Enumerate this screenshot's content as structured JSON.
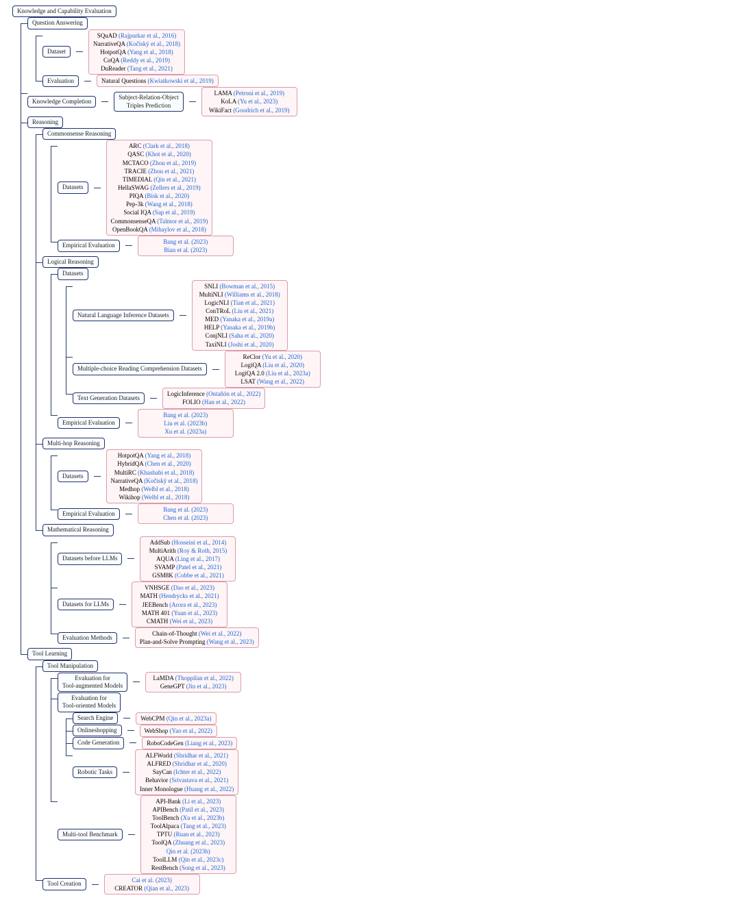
{
  "root": "Knowledge and Capability Evaluation",
  "qa": {
    "label": "Question Answering",
    "dataset": "Dataset",
    "dataset_items": [
      {
        "name": "SQuAD",
        "cite": "(Rajpurkar et al., 2016)"
      },
      {
        "name": "NarrativeQA",
        "cite": "(Kočiský et al., 2018)"
      },
      {
        "name": "HotpotQA",
        "cite": "(Yang et al., 2018)"
      },
      {
        "name": "CoQA",
        "cite": "(Reddy et al., 2019)"
      },
      {
        "name": "DuReader",
        "cite": "(Tang et al., 2021)"
      }
    ],
    "evaluation": "Evaluation",
    "eval_item": {
      "name": "Natural Questions",
      "cite": "(Kwiatkowski et al., 2019)"
    }
  },
  "kc": {
    "label": "Knowledge Completion",
    "sro": "Subject-Relation-Object\nTriples Prediction",
    "items": [
      {
        "name": "LAMA",
        "cite": "(Petroni et al., 2019)"
      },
      {
        "name": "KoLA",
        "cite": "(Yu et al., 2023)"
      },
      {
        "name": "WikiFact",
        "cite": "(Goodrich et al., 2019)"
      }
    ]
  },
  "reasoning": {
    "label": "Reasoning",
    "cs": {
      "label": "Commonsense Reasoning",
      "datasets": "Datasets",
      "ds_items": [
        {
          "name": "ARC",
          "cite": "(Clark et al., 2018)"
        },
        {
          "name": "QASC",
          "cite": "(Khot et al., 2020)"
        },
        {
          "name": "MCTACO",
          "cite": "(Zhou et al., 2019)"
        },
        {
          "name": "TRACIE",
          "cite": "(Zhou et al., 2021)"
        },
        {
          "name": "TIMEDIAL",
          "cite": "(Qin et al., 2021)"
        },
        {
          "name": "HellaSWAG",
          "cite": "(Zellers et al., 2019)"
        },
        {
          "name": "PIQA",
          "cite": "(Bisk et al., 2020)"
        },
        {
          "name": "Pep-3k",
          "cite": "(Wang et al., 2018)"
        },
        {
          "name": "Social IQA",
          "cite": "(Sap et al., 2019)"
        },
        {
          "name": "CommonsenseQA",
          "cite": "(Talmor et al., 2019)"
        },
        {
          "name": "OpenBookQA",
          "cite": "(Mihaylov et al., 2018)"
        }
      ],
      "emp": "Empirical Evaluation",
      "emp_items": [
        {
          "name": "",
          "cite": "Bang et al. (2023)"
        },
        {
          "name": "",
          "cite": "Bian et al. (2023)"
        }
      ]
    },
    "logical": {
      "label": "Logical Reasoning",
      "datasets": "Datasets",
      "nli": "Natural Language Inference Datasets",
      "nli_items": [
        {
          "name": "SNLI",
          "cite": "(Bowman et al., 2015)"
        },
        {
          "name": "MultiNLI",
          "cite": "(Williams et al., 2018)"
        },
        {
          "name": "LogicNLI",
          "cite": "(Tian et al., 2021)"
        },
        {
          "name": "ConTRoL",
          "cite": "(Liu et al., 2021)"
        },
        {
          "name": "MED",
          "cite": "(Yanaka et al., 2019a)"
        },
        {
          "name": "HELP",
          "cite": "(Yanaka et al., 2019b)"
        },
        {
          "name": "ConjNLI",
          "cite": "(Saha et al., 2020)"
        },
        {
          "name": "TaxiNLI",
          "cite": "(Joshi et al., 2020)"
        }
      ],
      "mcrc": "Multiple-choice Reading Comprehension Datasets",
      "mcrc_items": [
        {
          "name": "ReClor",
          "cite": "(Yu et al., 2020)"
        },
        {
          "name": "LogiQA",
          "cite": "(Liu et al., 2020)"
        },
        {
          "name": "LogiQA 2.0",
          "cite": "(Liu et al., 2023a)"
        },
        {
          "name": "LSAT",
          "cite": "(Wang et al., 2022)"
        }
      ],
      "tg": "Text Generation Datasets",
      "tg_items": [
        {
          "name": "LogicInference",
          "cite": "(Ontañón et al., 2022)"
        },
        {
          "name": "FOLIO",
          "cite": "(Han et al., 2022)"
        }
      ],
      "emp": "Empirical Evaluation",
      "emp_items": [
        {
          "name": "",
          "cite": "Bang et al. (2023)"
        },
        {
          "name": "",
          "cite": "Liu et al. (2023b)"
        },
        {
          "name": "",
          "cite": "Xu et al. (2023a)"
        }
      ]
    },
    "multihop": {
      "label": "Multi-hop Reasoning",
      "datasets": "Datasets",
      "ds_items": [
        {
          "name": "HotpotQA",
          "cite": "(Yang et al., 2018)"
        },
        {
          "name": "HybridQA",
          "cite": "(Chen et al., 2020)"
        },
        {
          "name": "MultiRC",
          "cite": "(Khashabi et al., 2018)"
        },
        {
          "name": "NarrativeQA",
          "cite": "(Kočiský et al., 2018)"
        },
        {
          "name": "Medhop",
          "cite": "(Welbl et al., 2018)"
        },
        {
          "name": "Wikihop",
          "cite": "(Welbl et al., 2018)"
        }
      ],
      "emp": "Empirical Evaluation",
      "emp_items": [
        {
          "name": "",
          "cite": "Bang et al. (2023)"
        },
        {
          "name": "",
          "cite": "Chen et al. (2023)"
        }
      ]
    },
    "math": {
      "label": "Mathematical Reasoning",
      "pre": "Datasets before LLMs",
      "pre_items": [
        {
          "name": "AddSub",
          "cite": "(Hosseini et al., 2014)"
        },
        {
          "name": "MultiArith",
          "cite": "(Roy & Roth, 2015)"
        },
        {
          "name": "AQUA",
          "cite": "(Ling et al., 2017)"
        },
        {
          "name": "SVAMP",
          "cite": "(Patel et al., 2021)"
        },
        {
          "name": "GSM8K",
          "cite": "(Cobbe et al., 2021)"
        }
      ],
      "for": "Datasets for LLMs",
      "for_items": [
        {
          "name": "VNHSGE",
          "cite": "(Dao et al., 2023)"
        },
        {
          "name": "MATH",
          "cite": "(Hendrycks et al., 2021)"
        },
        {
          "name": "JEEBench",
          "cite": "(Arora et al., 2023)"
        },
        {
          "name": "MATH 401",
          "cite": "(Yuan et al., 2023)"
        },
        {
          "name": "CMATH",
          "cite": "(Wei et al., 2023)"
        }
      ],
      "methods": "Evaluation Methods",
      "methods_items": [
        {
          "name": "Chain-of-Thought",
          "cite": "(Wei et al., 2022)"
        },
        {
          "name": "Plan-and-Solve Prompting",
          "cite": "(Wang et al., 2023)"
        }
      ]
    }
  },
  "tool": {
    "label": "Tool Learning",
    "manip": {
      "label": "Tool Manipulation",
      "aug": "Evaluation for\nTool-augmented Models",
      "aug_items": [
        {
          "name": "LaMDA",
          "cite": "(Thoppilan et al., 2022)"
        },
        {
          "name": "GeneGPT",
          "cite": "(Jin et al., 2023)"
        }
      ],
      "ori": "Evaluation for\nTool-oriented Models",
      "search": "Search Engine",
      "search_item": {
        "name": "WebCPM",
        "cite": "(Qin et al., 2023a)"
      },
      "shop": "Onlineshopping",
      "shop_item": {
        "name": "WebShop",
        "cite": "(Yao et al., 2022)"
      },
      "code": "Code Generation",
      "code_item": {
        "name": "RoboCodeGen",
        "cite": "(Liang et al., 2023)"
      },
      "robot": "Robotic Tasks",
      "robot_items": [
        {
          "name": "ALFWorld",
          "cite": "(Shridhar et al., 2021)"
        },
        {
          "name": "ALFRED",
          "cite": "(Shridhar et al., 2020)"
        },
        {
          "name": "SayCan",
          "cite": "(Ichter et al., 2022)"
        },
        {
          "name": "Behavior",
          "cite": "(Srivastava et al., 2021)"
        },
        {
          "name": "Inner Monologue",
          "cite": "(Huang et al., 2022)"
        }
      ],
      "multi": "Multi-tool Benchmark",
      "multi_items": [
        {
          "name": "API-Bank",
          "cite": "(Li et al., 2023)"
        },
        {
          "name": "APIBench",
          "cite": "(Patil et al., 2023)"
        },
        {
          "name": "ToolBench",
          "cite": "(Xu et al., 2023b)"
        },
        {
          "name": "ToolAlpaca",
          "cite": "(Tang et al., 2023)"
        },
        {
          "name": "TPTU",
          "cite": "(Ruan et al., 2023)"
        },
        {
          "name": "ToolQA",
          "cite": "(Zhuang et al., 2023)"
        },
        {
          "name": "",
          "cite": "Qin et al. (2023b)"
        },
        {
          "name": "ToolLLM",
          "cite": "(Qin et al., 2023c)"
        },
        {
          "name": "RestBench",
          "cite": "(Song et al., 2023)"
        }
      ]
    },
    "creation": {
      "label": "Tool Creation",
      "items": [
        {
          "name": "",
          "cite": "Cai et al. (2023)"
        },
        {
          "name": "CREATOR",
          "cite": "(Qian et al., 2023)"
        }
      ]
    }
  }
}
